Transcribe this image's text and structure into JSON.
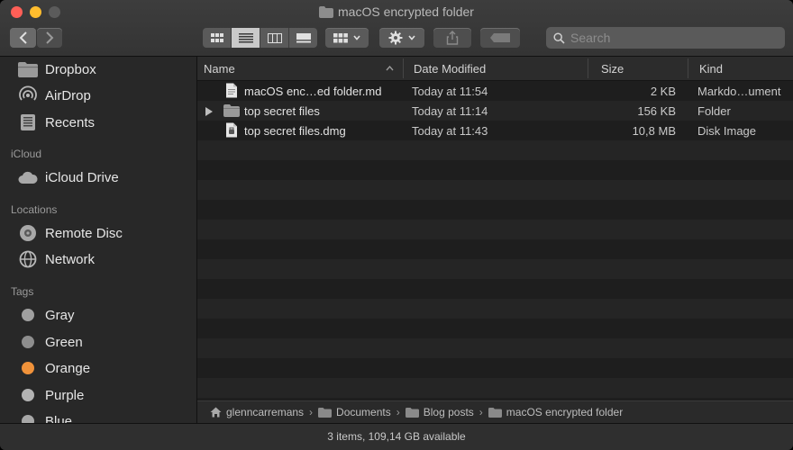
{
  "window": {
    "title": "macOS encrypted folder"
  },
  "toolbar": {
    "search_placeholder": "Search"
  },
  "sidebar": {
    "favorites": [
      {
        "label": "Dropbox",
        "icon": "dropbox-folder-icon"
      },
      {
        "label": "AirDrop",
        "icon": "airdrop-icon"
      },
      {
        "label": "Recents",
        "icon": "recents-icon"
      }
    ],
    "icloud_heading": "iCloud",
    "icloud": [
      {
        "label": "iCloud Drive",
        "icon": "cloud-icon"
      }
    ],
    "locations_heading": "Locations",
    "locations": [
      {
        "label": "Remote Disc",
        "icon": "disc-icon"
      },
      {
        "label": "Network",
        "icon": "globe-icon"
      }
    ],
    "tags_heading": "Tags",
    "tags": [
      {
        "label": "Gray",
        "color": "#a0a0a0"
      },
      {
        "label": "Green",
        "color": "#8e8e8e"
      },
      {
        "label": "Orange",
        "color": "#f0923a"
      },
      {
        "label": "Purple",
        "color": "#b3b3b3"
      },
      {
        "label": "Blue",
        "color": "#a8a8a8"
      }
    ]
  },
  "columns": {
    "name": "Name",
    "date": "Date Modified",
    "size": "Size",
    "kind": "Kind"
  },
  "files": [
    {
      "name": "macOS enc…ed folder.md",
      "date": "Today at 11:54",
      "size": "2 KB",
      "kind": "Markdo…ument",
      "icon": "document-icon"
    },
    {
      "name": "top secret files",
      "date": "Today at 11:14",
      "size": "156 KB",
      "kind": "Folder",
      "icon": "folder-icon"
    },
    {
      "name": "top secret files.dmg",
      "date": "Today at 11:43",
      "size": "10,8 MB",
      "kind": "Disk Image",
      "icon": "disk-image-icon"
    }
  ],
  "pathbar": [
    "glenncarremans",
    "Documents",
    "Blog posts",
    "macOS encrypted folder"
  ],
  "status": "3 items, 109,14 GB available"
}
